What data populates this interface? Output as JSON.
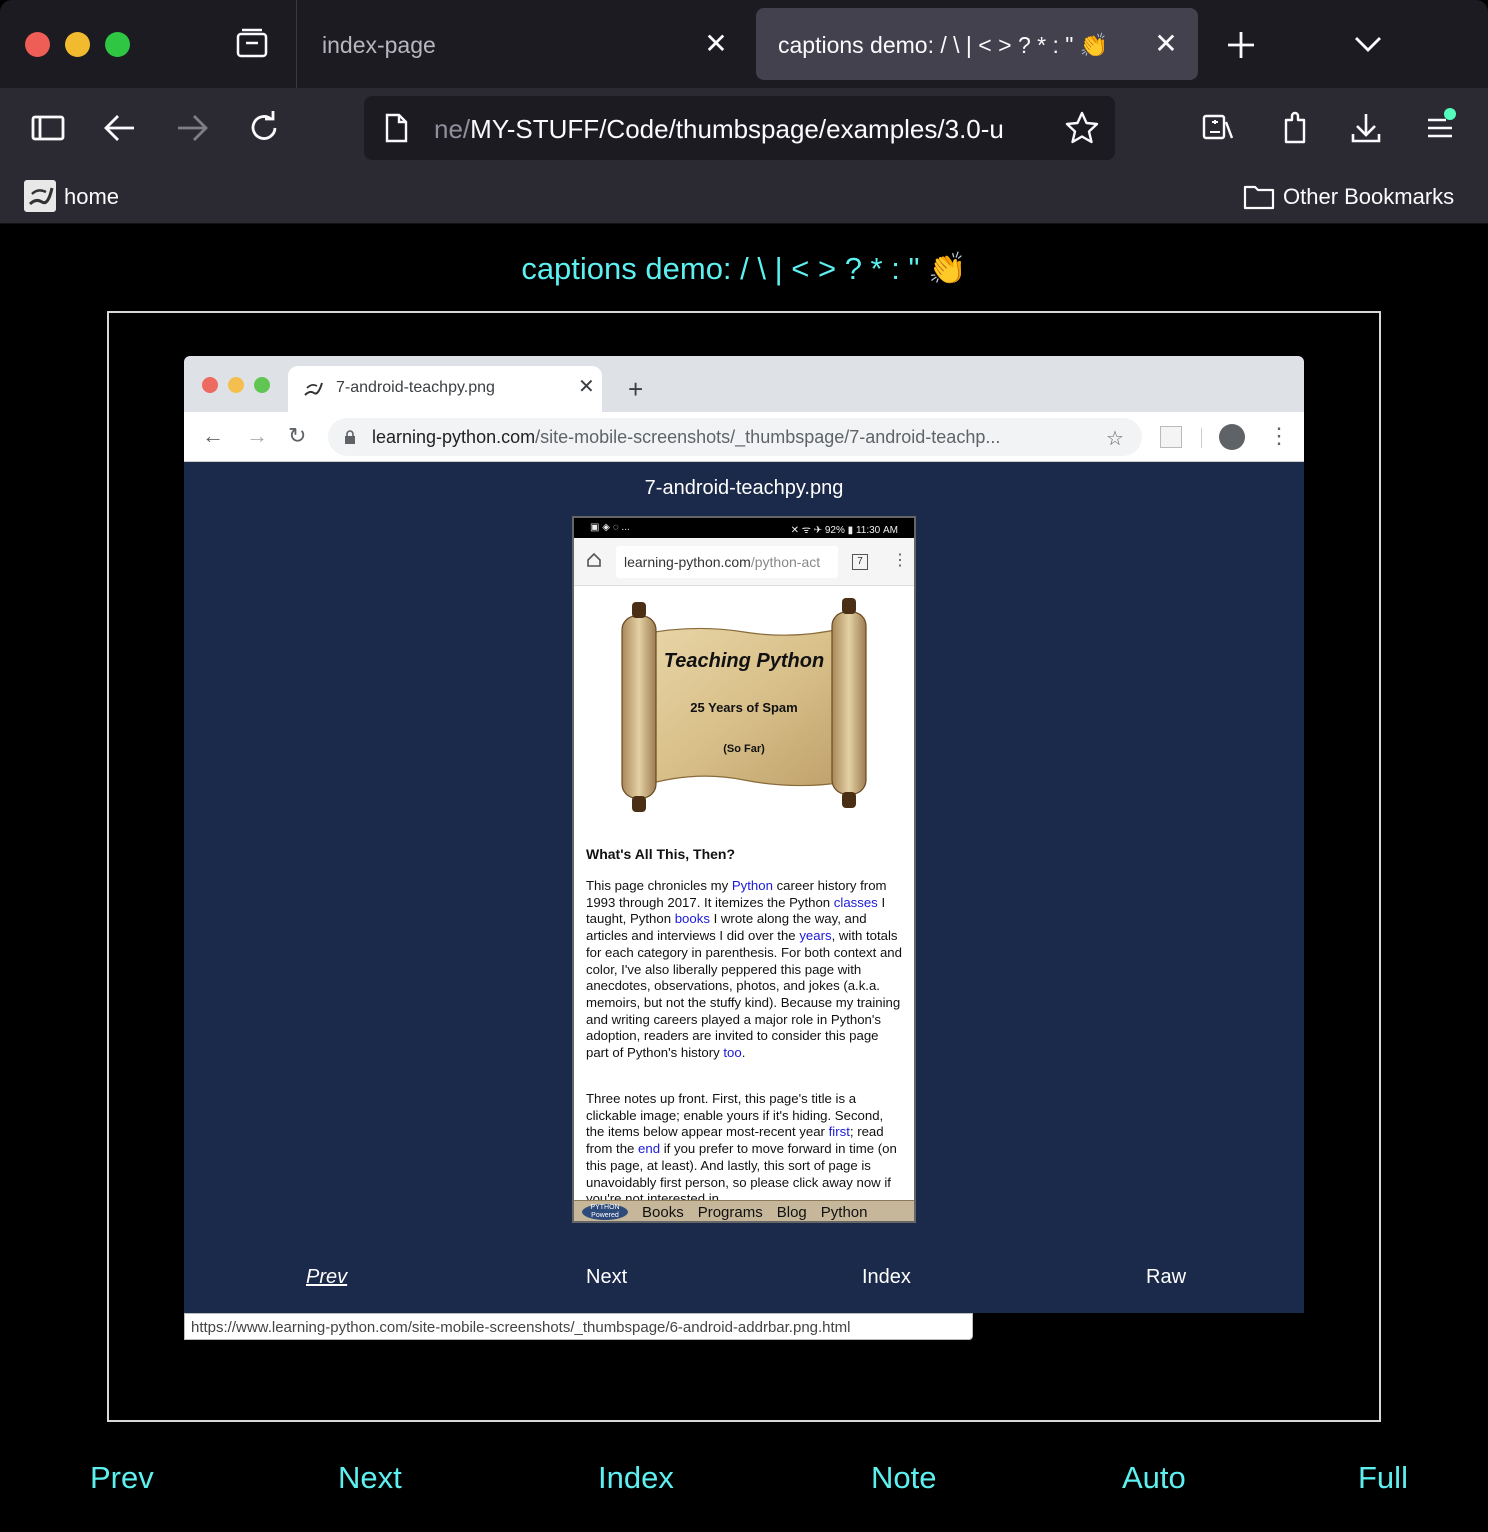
{
  "browser": {
    "tabs": [
      {
        "title": "index-page",
        "active": false
      },
      {
        "title": "captions demo: / \\ | < > ? * : \" 👏",
        "active": true
      }
    ],
    "url_dim": "ne/",
    "url_main": "MY-STUFF/Code/thumbspage/examples/3.0-u",
    "bookmarks": {
      "home": "home",
      "other": "Other Bookmarks"
    },
    "close_glyph": "✕"
  },
  "page": {
    "title": "captions demo: / \\ | < > ? * : \" 👏",
    "nav": [
      "Prev",
      "Next",
      "Index",
      "Note",
      "Auto",
      "Full"
    ]
  },
  "inner": {
    "tab_title": "7-android-teachpy.png",
    "url_host": "learning-python.com",
    "url_path": "/site-mobile-screenshots/_thumbspage/7-android-teachp...",
    "caption": "7-android-teachpy.png",
    "nav": [
      "Prev",
      "Next",
      "Index",
      "Raw"
    ],
    "status_url": "https://www.learning-python.com/site-mobile-screenshots/_thumbspage/6-android-addrbar.png.html"
  },
  "phone": {
    "status_left": "▣ ◈ ◌ ...",
    "status_right": "✕ ᯤ ✈ 92% ▮ 11:30 AM",
    "url_host": "learning-python.com",
    "url_path": "/python-act",
    "tab_count": "7",
    "scroll_title": "Teaching Python",
    "scroll_sub": "25 Years of Spam",
    "scroll_sub2": "(So Far)",
    "heading": "What's All This, Then?",
    "p1": {
      "a": "This page chronicles my ",
      "l1": "Python",
      "b": " career history from 1993 through 2017. It itemizes the Python ",
      "l2": "classes",
      "c": " I taught, Python ",
      "l3": "books",
      "d": " I wrote along the way, and articles and interviews I did over the ",
      "l4": "years",
      "e": ", with totals for each category in parenthesis. For both context and color, I've also liberally peppered this page with anecdotes, observations, photos, and jokes (a.k.a. memoirs, but not the stuffy kind). Because my training and writing careers played a major role in Python's adoption, readers are invited to consider this page part of Python's history ",
      "l5": "too",
      "f": "."
    },
    "p2": {
      "a": "Three notes up front. First, this page's title is a clickable image; enable yours if it's hiding. Second, the items below appear most-recent year ",
      "l1": "first",
      "b": "; read from the ",
      "l2": "end",
      "c": " if you prefer to move forward in time (on this page, at least). And lastly, this sort of page is unavoidably first person, so please click away now if you're not interested in"
    },
    "python_logo": "PYTHON Powered",
    "bottom_links": [
      "Books",
      "Programs",
      "Blog",
      "Python"
    ]
  }
}
